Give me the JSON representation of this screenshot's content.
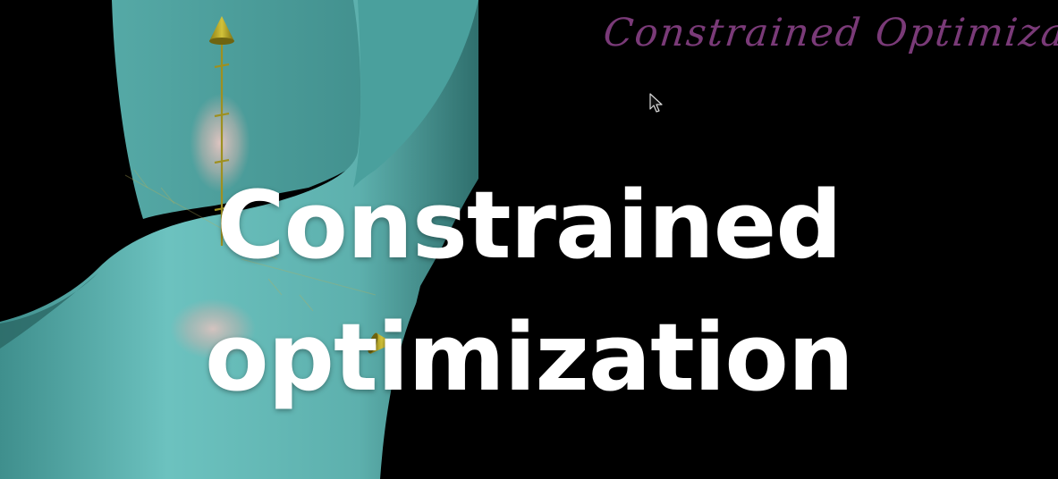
{
  "thumbnail": {
    "handwritten_heading": "Constrained Optimization",
    "title_line_1": "Constrained",
    "title_line_2": "optimization"
  },
  "colors": {
    "background": "#000000",
    "surface": "#5fb3b0",
    "surface_highlight": "#c9b4b0",
    "axis": "#b5a321",
    "handwriting": "#7a3a78",
    "title": "#ffffff"
  },
  "icons": {
    "cursor": "mouse-pointer-icon",
    "axis_arrow": "cone-arrow-icon"
  }
}
